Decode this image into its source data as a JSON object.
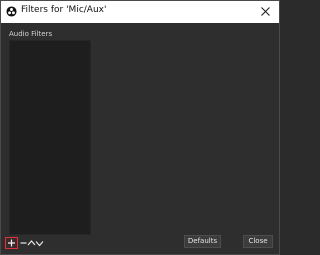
{
  "window": {
    "title": "Filters for 'Mic/Aux'",
    "app_icon": "obs-logo-icon",
    "close_icon": "close-icon"
  },
  "audio_filters": {
    "label": "Audio Filters",
    "items": []
  },
  "toolbar": {
    "add_icon": "plus-icon",
    "remove_icon": "minus-icon",
    "move_up_icon": "chevron-up-icon",
    "move_down_icon": "chevron-down-icon"
  },
  "buttons": {
    "defaults": "Defaults",
    "close": "Close"
  },
  "colors": {
    "background": "#2e2e2e",
    "list_background": "#1e1e1e",
    "titlebar": "#ffffff",
    "add_highlight": "#e0303a"
  }
}
